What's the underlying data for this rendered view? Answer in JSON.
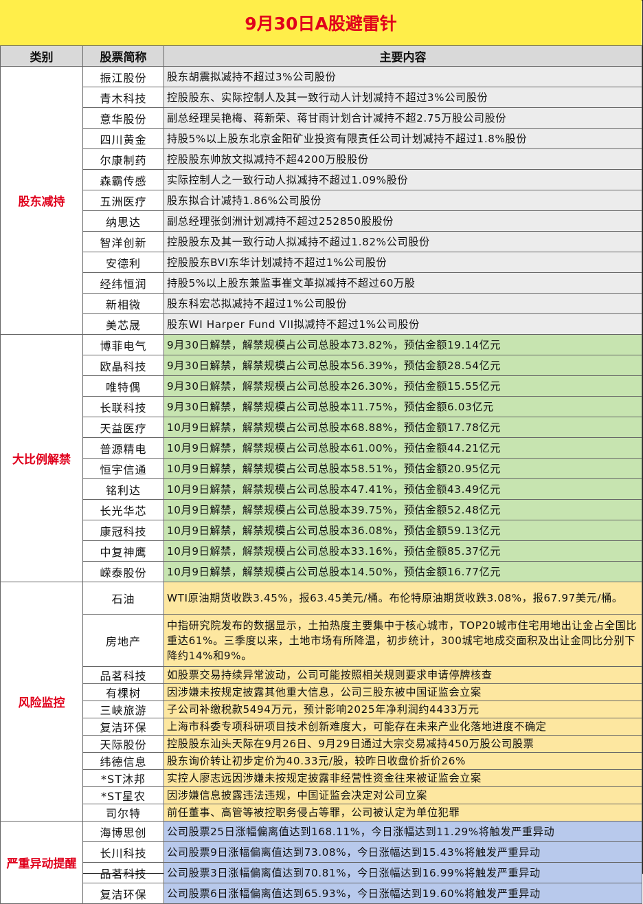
{
  "title": "9月30日A股避雷针",
  "headers": {
    "category": "类别",
    "name": "股票简称",
    "content": "主要内容"
  },
  "groups": {
    "reduce": {
      "label": "股东减持",
      "rows": [
        {
          "name": "振江股份",
          "content": "股东胡震拟减持不超过3%公司股份"
        },
        {
          "name": "青木科技",
          "content": "控股股东、实际控制人及其一致行动人计划减持不超过3%公司股份"
        },
        {
          "name": "意华股份",
          "content": "副总经理吴艳梅、蒋新荣、蒋甘雨计划合计减持不超2.75万股公司股份"
        },
        {
          "name": "四川黄金",
          "content": "持股5%以上股东北京金阳矿业投资有限责任公司计划减持不超过1.8%股份"
        },
        {
          "name": "尔康制药",
          "content": "控股股东帅放文拟减持不超4200万股股份"
        },
        {
          "name": "森霸传感",
          "content": "实际控制人之一致行动人拟减持不超过1.09%股份"
        },
        {
          "name": "五洲医疗",
          "content": "股东拟合计减持1.86%公司股份"
        },
        {
          "name": "纳思达",
          "content": "副总经理张剑洲计划减持不超过252850股股份"
        },
        {
          "name": "智洋创新",
          "content": "控股股东及其一致行动人拟减持不超过1.82%公司股份"
        },
        {
          "name": "安德利",
          "content": "控股股东BVI东华计划减持不超过1%公司股份"
        },
        {
          "name": "经纬恒润",
          "content": "持股5%以上股东兼监事崔文革拟减持不超过60万股"
        },
        {
          "name": "新相微",
          "content": "股东科宏芯拟减持不超过1%公司股份"
        },
        {
          "name": "美芯晟",
          "content": "股东WI Harper Fund VII拟减持不超过1%公司股份"
        }
      ]
    },
    "unlock": {
      "label": "大比例解禁",
      "rows": [
        {
          "name": "博菲电气",
          "content": "9月30日解禁，解禁规模占公司总股本73.82%，预估金额19.14亿元"
        },
        {
          "name": "欧晶科技",
          "content": "9月30日解禁，解禁规模占公司总股本56.39%，预估金额28.54亿元"
        },
        {
          "name": "唯特偶",
          "content": "9月30日解禁，解禁规模占公司总股本26.30%，预估金额15.55亿元"
        },
        {
          "name": "长联科技",
          "content": "9月30日解禁，解禁规模占公司总股本11.75%，预估金额6.03亿元"
        },
        {
          "name": "天益医疗",
          "content": "10月9日解禁，解禁规模占公司总股本68.88%，预估金额17.78亿元"
        },
        {
          "name": "普源精电",
          "content": "10月9日解禁，解禁规模占公司总股本61.00%，预估金额44.21亿元"
        },
        {
          "name": "恒宇信通",
          "content": "10月9日解禁，解禁规模占公司总股本58.51%，预估金额20.95亿元"
        },
        {
          "name": "铭利达",
          "content": "10月9日解禁，解禁规模占公司总股本47.41%，预估金额43.49亿元"
        },
        {
          "name": "长光华芯",
          "content": "10月9日解禁，解禁规模占公司总股本39.75%，预估金额52.48亿元"
        },
        {
          "name": "康冠科技",
          "content": "10月9日解禁，解禁规模占公司总股本36.08%，预估金额59.13亿元"
        },
        {
          "name": "中复神鹰",
          "content": "10月9日解禁，解禁规模占公司总股本33.16%，预估金额85.37亿元"
        },
        {
          "name": "嵘泰股份",
          "content": "10月9日解禁，解禁规模占公司总股本14.50%，预估金额16.77亿元"
        }
      ]
    },
    "risk": {
      "label": "风险监控",
      "rows": [
        {
          "name": "石油",
          "content": "WTI原油期货收跌3.45%，报63.45美元/桶。布伦特原油期货收跌3.08%，报67.97美元/桶。"
        },
        {
          "name": "房地产",
          "content": "中指研究院发布的数据显示，土拍热度主要集中于核心城市，TOP20城市住宅用地出让金占全国比重达61%。三季度以来，土地市场有所降温，初步统计，300城宅地成交面积及出让金同比分别下降约14%和9%。"
        },
        {
          "name": "品茗科技",
          "content": "如股票交易持续异常波动，公司可能按照相关规则要求申请停牌核查"
        },
        {
          "name": "有棵树",
          "content": "因涉嫌未按规定披露其他重大信息，公司三股东被中国证监会立案"
        },
        {
          "name": "三峡旅游",
          "content": "子公司补缴税款5494万元，预计影响2025年净利润约4433万元"
        },
        {
          "name": "复洁环保",
          "content": "上海市科委专项科研项目技术创新难度大，可能存在未来产业化落地进度不确定"
        },
        {
          "name": "天际股份",
          "content": "控股股东汕头天际在9月26日、9月29日通过大宗交易减持450万股公司股票"
        },
        {
          "name": "纬德信息",
          "content": "股东询价转让初步定价为40.33元/股，较昨日收盘价折价26%"
        },
        {
          "name": "*ST沐邦",
          "content": "实控人廖志远因涉嫌未按规定披露非经营性资金往来被证监会立案"
        },
        {
          "name": "*ST星农",
          "content": "因涉嫌信息披露违法违规，中国证监会决定对公司立案"
        },
        {
          "name": "司尔特",
          "content": "前任董事、高管等被控职务侵占等罪，公司被认定为单位犯罪"
        }
      ]
    },
    "abn": {
      "label": "严重异动提醒",
      "rows": [
        {
          "name": "海博思创",
          "content": "公司股票25日涨幅偏离值达到168.11%，今日涨幅达到11.29%将触发严重异动"
        },
        {
          "name": "长川科技",
          "content": "公司股票9日涨幅偏离值达到73.08%，今日涨幅达到15.43%将触发严重异动"
        },
        {
          "name": "品茗科技",
          "content": "公司股票3日涨幅偏离值达到70.81%，今日涨幅达到16.99%将触发严重异动"
        },
        {
          "name": "复洁环保",
          "content": "公司股票6日涨幅偏离值达到65.93%，今日涨幅达到19.60%将触发严重异动"
        }
      ]
    }
  }
}
